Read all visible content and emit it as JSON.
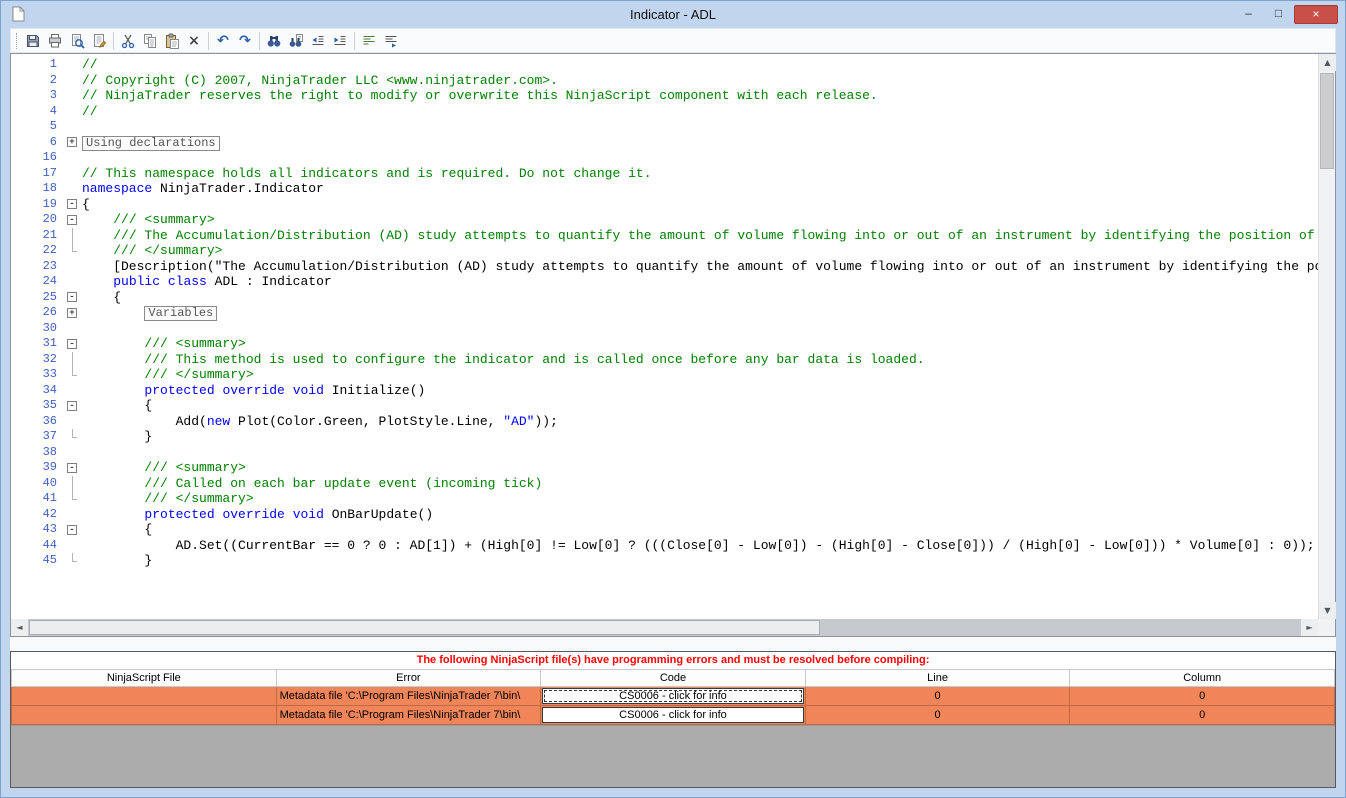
{
  "colors": {
    "titlebarBg": "#c2d5ee",
    "windowBorder": "#7ba3d0",
    "closeBtn": "#c85048",
    "comment": "#008000",
    "keyword": "#0000ff",
    "stringLit": "#0000ff",
    "lineNumber": "#4060c0",
    "errorText": "#ff0000",
    "errorRowBg": "#f0855a",
    "panelGray": "#acacac"
  },
  "window": {
    "title": "Indicator - ADL",
    "controls": {
      "minimize": "–",
      "maximize": "□",
      "close": "×"
    }
  },
  "scrollbar": {
    "up": "▲",
    "down": "▼",
    "left": "◄",
    "right": "►"
  },
  "toolbar": {
    "items": [
      {
        "name": "save"
      },
      {
        "name": "print"
      },
      {
        "name": "print-preview"
      },
      {
        "name": "page-setup"
      },
      "|",
      {
        "name": "cut"
      },
      {
        "name": "copy"
      },
      {
        "name": "paste"
      },
      {
        "name": "delete",
        "glyph": "×",
        "color": "#444444"
      },
      "|",
      {
        "name": "undo",
        "glyph": "↶",
        "color": "#2b5fa8"
      },
      {
        "name": "redo",
        "glyph": "↷",
        "color": "#2b5fa8"
      },
      "|",
      {
        "name": "find"
      },
      {
        "name": "replace"
      },
      {
        "name": "outdent"
      },
      {
        "name": "indent"
      },
      "|",
      {
        "name": "comment"
      },
      {
        "name": "uncomment"
      }
    ]
  },
  "editor": {
    "lines": [
      {
        "n": "1",
        "f": "",
        "s": [
          [
            "//",
            "c"
          ]
        ]
      },
      {
        "n": "2",
        "f": "",
        "s": [
          [
            "// Copyright (C) 2007, NinjaTrader LLC <www.ninjatrader.com>.",
            "c"
          ]
        ]
      },
      {
        "n": "3",
        "f": "",
        "s": [
          [
            "// NinjaTrader reserves the right to modify or overwrite this NinjaScript component with each release.",
            "c"
          ]
        ]
      },
      {
        "n": "4",
        "f": "",
        "s": [
          [
            "//",
            "c"
          ]
        ]
      },
      {
        "n": "5",
        "f": "",
        "s": []
      },
      {
        "n": "6",
        "f": "+",
        "s": [
          [
            "Using declarations",
            "box"
          ]
        ]
      },
      {
        "n": "16",
        "f": "",
        "s": []
      },
      {
        "n": "17",
        "f": "",
        "s": [
          [
            "// This namespace holds all indicators and is required. Do not change it.",
            "c"
          ]
        ]
      },
      {
        "n": "18",
        "f": "",
        "s": [
          [
            "namespace",
            "k"
          ],
          [
            " NinjaTrader.Indicator",
            "p"
          ]
        ]
      },
      {
        "n": "19",
        "f": "-",
        "s": [
          [
            "{",
            "p"
          ]
        ]
      },
      {
        "n": "20",
        "f": "-",
        "s": [
          [
            "    ",
            "p"
          ],
          [
            "/// <summary>",
            "c"
          ]
        ]
      },
      {
        "n": "21",
        "f": "|",
        "s": [
          [
            "    ",
            "p"
          ],
          [
            "/// The Accumulation/Distribution (AD) study attempts to quantify the amount of volume flowing into or out of an instrument by identifying the position of the close of the period in relation to that period's high/low range.",
            "c"
          ]
        ]
      },
      {
        "n": "22",
        "f": "e",
        "s": [
          [
            "    ",
            "p"
          ],
          [
            "/// </summary>",
            "c"
          ]
        ]
      },
      {
        "n": "23",
        "f": "",
        "s": [
          [
            "    [Description(\"The Accumulation/Distribution (AD) study attempts to quantify the amount of volume flowing into or out of an instrument by identifying the position of the close of the period in relation to that period's high/low range.\")]",
            "p"
          ]
        ]
      },
      {
        "n": "24",
        "f": "",
        "s": [
          [
            "    ",
            "p"
          ],
          [
            "public",
            "k"
          ],
          [
            " ",
            "p"
          ],
          [
            "class",
            "k"
          ],
          [
            " ADL : Indicator",
            "p"
          ]
        ]
      },
      {
        "n": "25",
        "f": "-",
        "s": [
          [
            "    {",
            "p"
          ]
        ]
      },
      {
        "n": "26",
        "f": "+",
        "s": [
          [
            "        ",
            "p"
          ],
          [
            "Variables",
            "box"
          ]
        ]
      },
      {
        "n": "30",
        "f": "",
        "s": []
      },
      {
        "n": "31",
        "f": "-",
        "s": [
          [
            "        ",
            "p"
          ],
          [
            "/// <summary>",
            "c"
          ]
        ]
      },
      {
        "n": "32",
        "f": "|",
        "s": [
          [
            "        ",
            "p"
          ],
          [
            "/// This method is used to configure the indicator and is called once before any bar data is loaded.",
            "c"
          ]
        ]
      },
      {
        "n": "33",
        "f": "e",
        "s": [
          [
            "        ",
            "p"
          ],
          [
            "/// </summary>",
            "c"
          ]
        ]
      },
      {
        "n": "34",
        "f": "",
        "s": [
          [
            "        ",
            "p"
          ],
          [
            "protected",
            "k"
          ],
          [
            " ",
            "p"
          ],
          [
            "override",
            "k"
          ],
          [
            " ",
            "p"
          ],
          [
            "void",
            "k"
          ],
          [
            " Initialize()",
            "p"
          ]
        ]
      },
      {
        "n": "35",
        "f": "-",
        "s": [
          [
            "        {",
            "p"
          ]
        ]
      },
      {
        "n": "36",
        "f": "",
        "s": [
          [
            "            Add(",
            "p"
          ],
          [
            "new",
            "k"
          ],
          [
            " Plot(Color.Green, PlotStyle.Line, ",
            "p"
          ],
          [
            "\"AD\"",
            "s"
          ],
          [
            "));",
            "p"
          ]
        ]
      },
      {
        "n": "37",
        "f": "e",
        "s": [
          [
            "        }",
            "p"
          ]
        ]
      },
      {
        "n": "38",
        "f": "",
        "s": []
      },
      {
        "n": "39",
        "f": "-",
        "s": [
          [
            "        ",
            "p"
          ],
          [
            "/// <summary>",
            "c"
          ]
        ]
      },
      {
        "n": "40",
        "f": "|",
        "s": [
          [
            "        ",
            "p"
          ],
          [
            "/// Called on each bar update event (incoming tick)",
            "c"
          ]
        ]
      },
      {
        "n": "41",
        "f": "e",
        "s": [
          [
            "        ",
            "p"
          ],
          [
            "/// </summary>",
            "c"
          ]
        ]
      },
      {
        "n": "42",
        "f": "",
        "s": [
          [
            "        ",
            "p"
          ],
          [
            "protected",
            "k"
          ],
          [
            " ",
            "p"
          ],
          [
            "override",
            "k"
          ],
          [
            " ",
            "p"
          ],
          [
            "void",
            "k"
          ],
          [
            " OnBarUpdate()",
            "p"
          ]
        ]
      },
      {
        "n": "43",
        "f": "-",
        "s": [
          [
            "        {",
            "p"
          ]
        ]
      },
      {
        "n": "44",
        "f": "",
        "s": [
          [
            "            AD.Set((CurrentBar == 0 ? 0 : AD[1]) + (High[0] != Low[0] ? (((Close[0] - Low[0]) - (High[0] - Close[0])) / (High[0] - Low[0])) * Volume[0] : 0));",
            "p"
          ]
        ]
      },
      {
        "n": "45",
        "f": "e",
        "s": [
          [
            "        }",
            "p"
          ]
        ]
      }
    ]
  },
  "errorPanel": {
    "message": "The following NinjaScript file(s) have programming errors and must be resolved before compiling:",
    "columns": [
      "NinjaScript File",
      "Error",
      "Code",
      "Line",
      "Column"
    ],
    "rows": [
      {
        "file": "",
        "error": "Metadata file 'C:\\Program Files\\NinjaTrader 7\\bin\\",
        "code": "CS0006 - click for info",
        "line": "0",
        "column": "0",
        "selected": true
      },
      {
        "file": "",
        "error": "Metadata file 'C:\\Program Files\\NinjaTrader 7\\bin\\",
        "code": "CS0006 - click for info",
        "line": "0",
        "column": "0",
        "selected": false
      }
    ]
  }
}
